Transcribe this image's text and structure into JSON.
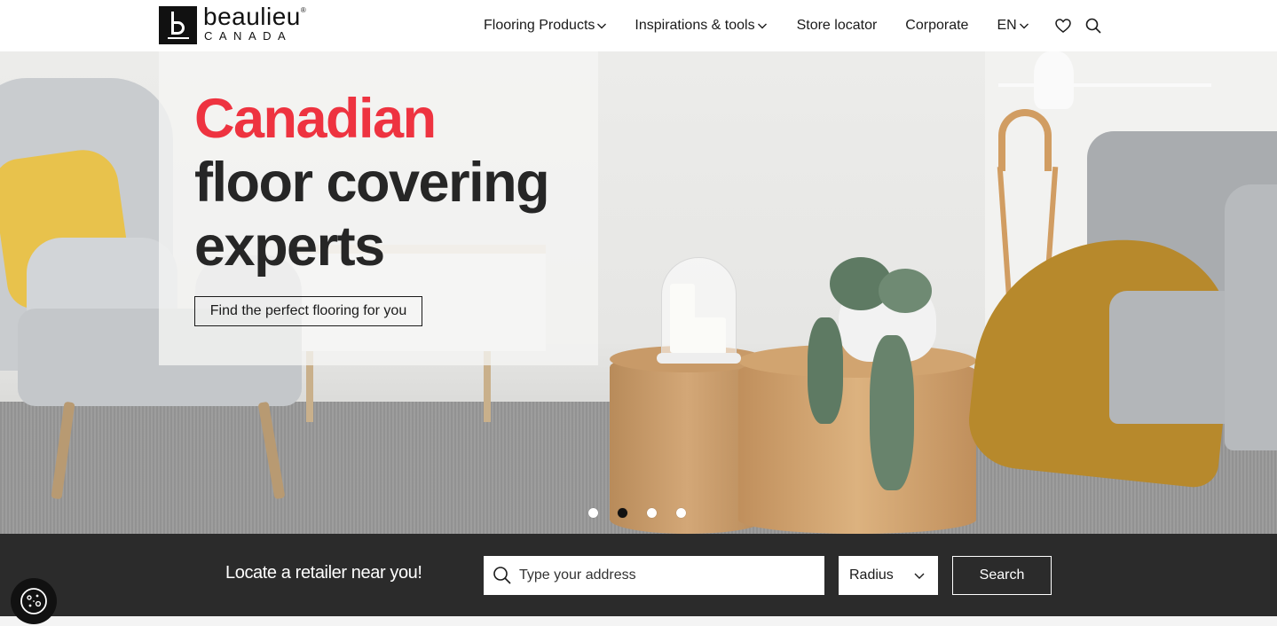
{
  "brand": {
    "name": "beaulieu",
    "trademark": "®",
    "sub": "CANADA"
  },
  "nav": {
    "items": [
      {
        "label": "Flooring Products"
      },
      {
        "label": "Inspirations & tools"
      },
      {
        "label": "Store locator"
      },
      {
        "label": "Corporate"
      },
      {
        "label": "EN"
      }
    ]
  },
  "hero": {
    "headline_line1": "Canadian",
    "headline_line2": "floor covering",
    "headline_line3": "experts",
    "cta_label": "Find the perfect flooring for you",
    "slides": {
      "count": 4,
      "active_index": 1
    }
  },
  "locator": {
    "title": "Locate a retailer near you!",
    "address_placeholder": "Type your address",
    "radius_label": "Radius",
    "search_label": "Search"
  },
  "colors": {
    "accent_red": "#ee3340",
    "dark_bar": "#2b2b2b"
  },
  "icons": {
    "wishlist": "heart-icon",
    "search": "search-icon",
    "chevron": "chevron-down-icon",
    "cookie": "cookie-icon"
  }
}
